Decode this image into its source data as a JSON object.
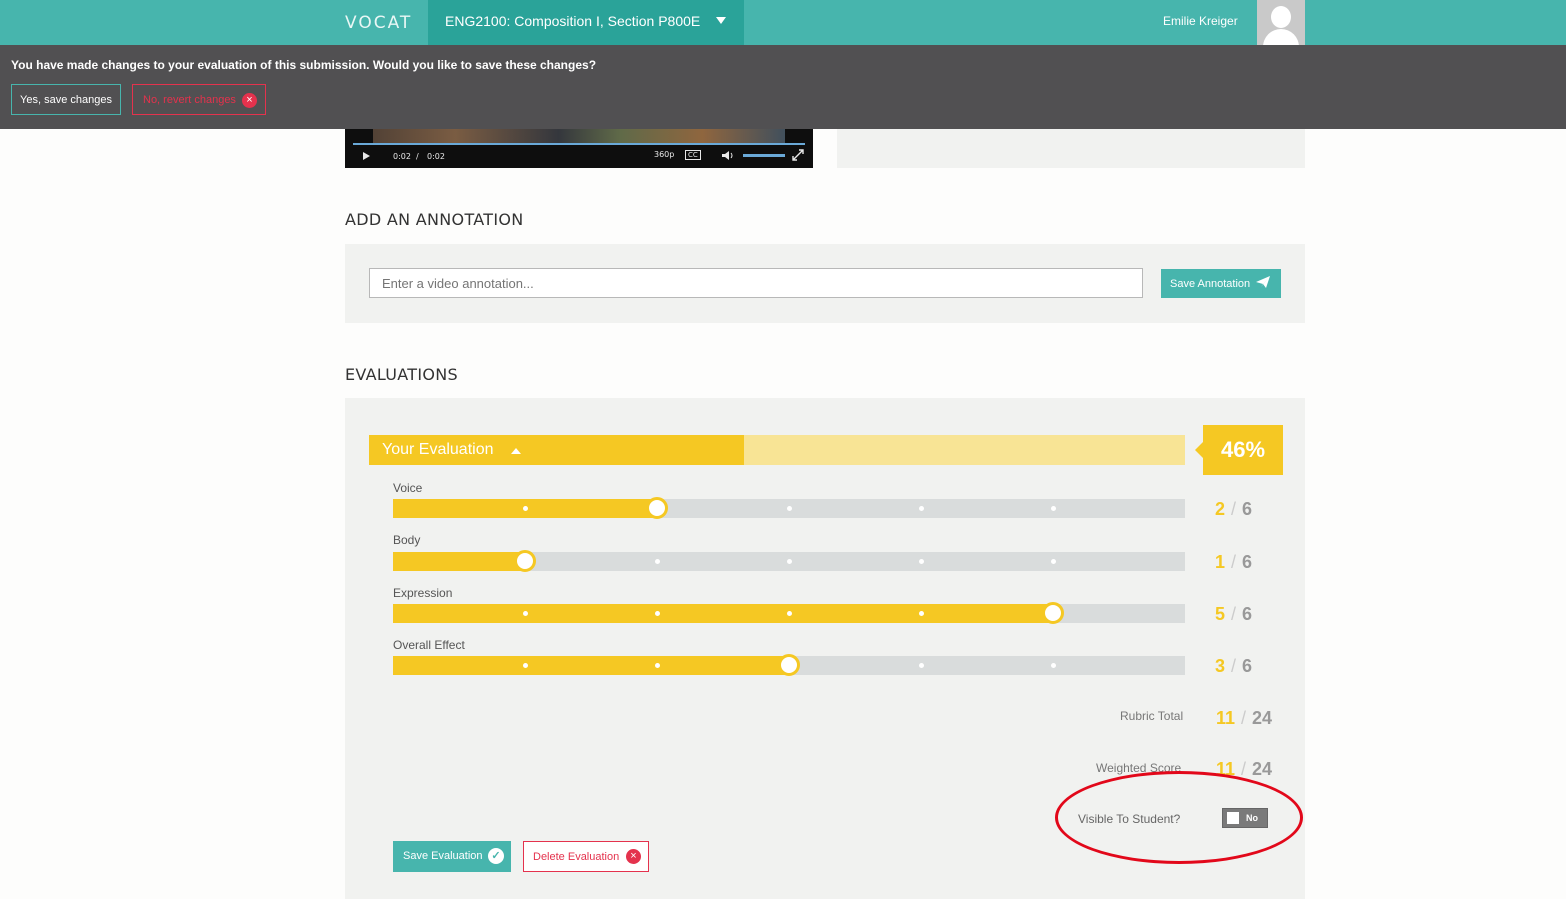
{
  "header": {
    "logo": "VOCAT",
    "course": "ENG2100: Composition I, Section P800E",
    "username": "Emilie Kreiger"
  },
  "alert": {
    "message": "You have made changes to your evaluation of this submission. Would you like to save these changes?",
    "save_label": "Yes, save changes",
    "revert_label": "No, revert changes"
  },
  "video": {
    "current_time": "0:02",
    "separator": "/",
    "duration": "0:02",
    "quality": "360p",
    "cc": "CC"
  },
  "annotation": {
    "heading": "ADD AN ANNOTATION",
    "placeholder": "Enter a video annotation...",
    "save_label": "Save Annotation"
  },
  "evaluations": {
    "heading": "EVALUATIONS",
    "your_eval_label": "Your Evaluation",
    "percent": "46%",
    "percent_value": 0.46,
    "criteria": [
      {
        "name": "Voice",
        "score": "2",
        "max": "6"
      },
      {
        "name": "Body",
        "score": "1",
        "max": "6"
      },
      {
        "name": "Expression",
        "score": "5",
        "max": "6"
      },
      {
        "name": "Overall Effect",
        "score": "3",
        "max": "6"
      }
    ],
    "rubric_total_label": "Rubric Total",
    "rubric_total": "11",
    "rubric_max": "24",
    "weighted_label": "Weighted Score",
    "weighted": "11",
    "weighted_max": "24",
    "visible_label": "Visible To Student?",
    "visible_value": "No",
    "save_label": "Save Evaluation",
    "delete_label": "Delete Evaluation"
  },
  "colors": {
    "teal": "#47b5ad",
    "yellow": "#f5c823",
    "red": "#e4324d",
    "banner": "#515052"
  }
}
